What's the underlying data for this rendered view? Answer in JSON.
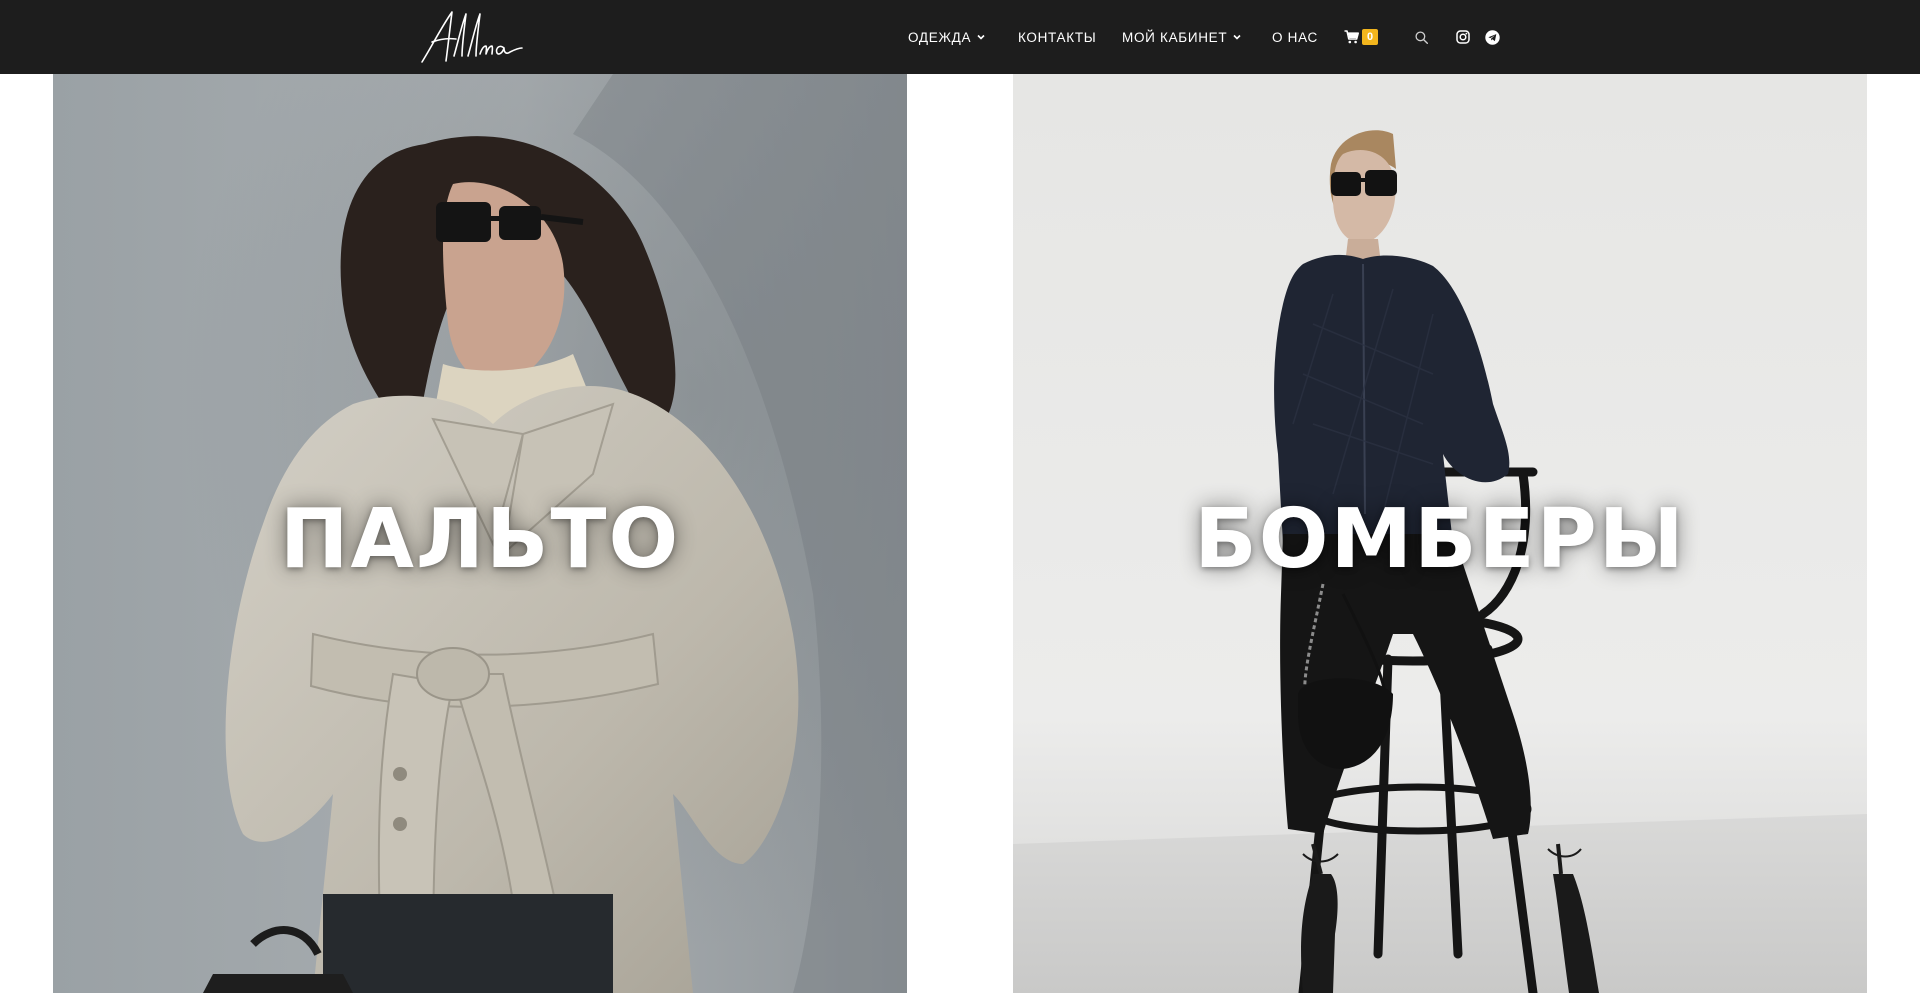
{
  "header": {
    "logo_text": "Allma",
    "nav": [
      {
        "label": "ОДЕЖДА",
        "has_dropdown": true
      },
      {
        "label": "КОНТАКТЫ",
        "has_dropdown": false
      },
      {
        "label": "МОЙ КАБИНЕТ",
        "has_dropdown": true
      },
      {
        "label": "О НАС",
        "has_dropdown": false
      }
    ],
    "cart": {
      "icon": "cart-icon",
      "count": "0"
    },
    "search_icon": "search-icon",
    "social_icons": [
      "instagram-icon",
      "telegram-icon"
    ]
  },
  "tiles": [
    {
      "title": "ПАЛЬТО"
    },
    {
      "title": "БОМБЕРЫ"
    }
  ],
  "colors": {
    "header_bg": "#1d1d1d",
    "cart_badge": "#f2b51d",
    "text_on_dark": "#ffffff"
  }
}
